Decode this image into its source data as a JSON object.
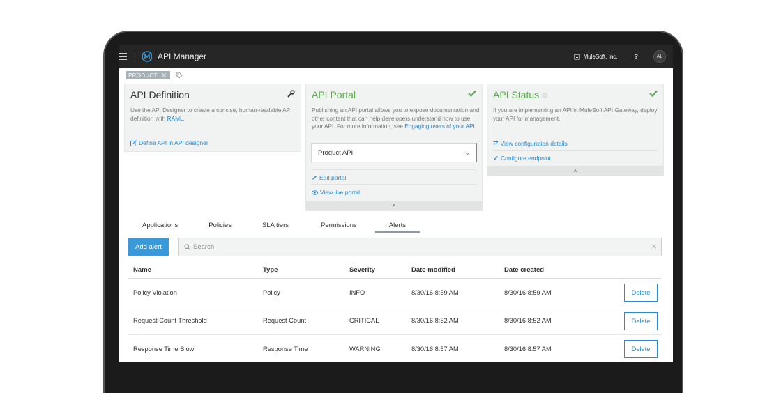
{
  "topbar": {
    "app_title": "API Manager",
    "org": "MuleSoft, Inc.",
    "help": "?",
    "avatar": "AL"
  },
  "tag": {
    "label": "PRODUCT",
    "remove": "✕"
  },
  "cards": {
    "definition": {
      "title": "API Definition",
      "desc_text": "Use the API Designer to create a concise, human-readable API definition with ",
      "desc_link": "RAML",
      "desc_end": ".",
      "link": "Define API in API designer"
    },
    "portal": {
      "title": "API Portal",
      "desc_text": "Publishing an API portal allows you to expose documentation and other content that can help developers understand how to use your API. For more information, see ",
      "desc_link": "Engaging users of your API",
      "desc_end": ".",
      "select_value": "Product API",
      "edit_link": "Edit portal",
      "view_link": "View live portal"
    },
    "status": {
      "title": "API Status",
      "desc": "If you are implementing an API in MuleSoft API Gateway, deploy your API for management.",
      "config_link": "View configuration details",
      "endpoint_link": "Configure endpoint"
    }
  },
  "tabs": [
    "Applications",
    "Policies",
    "SLA tiers",
    "Permissions",
    "Alerts"
  ],
  "active_tab": "Alerts",
  "add_alert": "Add alert",
  "search": {
    "placeholder": "Search"
  },
  "table": {
    "headers": {
      "name": "Name",
      "type": "Type",
      "severity": "Severity",
      "modified": "Date modified",
      "created": "Date created"
    },
    "rows": [
      {
        "name": "Policy Violation",
        "type": "Policy",
        "severity": "INFO",
        "modified": "8/30/16 8:59 AM",
        "created": "8/30/16 8:59 AM",
        "action": "Delete"
      },
      {
        "name": "Request Count Threshold",
        "type": "Request Count",
        "severity": "CRITICAL",
        "modified": "8/30/16 8:52 AM",
        "created": "8/30/16 8:52 AM",
        "action": "Delete"
      },
      {
        "name": "Response Time Slow",
        "type": "Response Time",
        "severity": "WARNING",
        "modified": "8/30/16 8:57 AM",
        "created": "8/30/16 8:57 AM",
        "action": "Delete"
      }
    ]
  },
  "colors": {
    "accent": "#3a9ad9",
    "success": "#5aaa4c",
    "topbar": "#262626"
  }
}
